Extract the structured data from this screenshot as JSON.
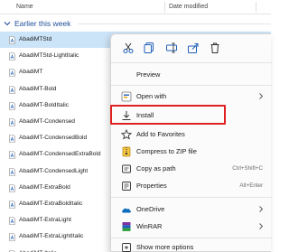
{
  "columns": {
    "name": "Name",
    "date": "Date modified"
  },
  "group": {
    "label": "Earlier this week"
  },
  "files": [
    "AbadiMTStd",
    "AbadiMTStd-LightItalic",
    "AbadiMT",
    "AbadiMT-Bold",
    "AbadiMT-BoldItalic",
    "AbadiMT-Condensed",
    "AbadiMT-CondensedBold",
    "AbadiMT-CondensedExtraBold",
    "AbadiMT-CondensedLight",
    "AbadiMT-ExtraBold",
    "AbadiMT-ExtraBoldItalic",
    "AbadiMT-ExtraLight",
    "AbadiMT-ExtraLightItalic",
    "AbadiMT-Italic"
  ],
  "context_menu": {
    "quick_actions": [
      "cut-icon",
      "copy-icon",
      "rename-icon",
      "share-icon",
      "delete-icon"
    ],
    "preview": "Preview",
    "open_with": "Open with",
    "install": "Install",
    "add_favorites": "Add to Favorites",
    "compress": "Compress to ZIP file",
    "copy_path": "Copy as path",
    "copy_path_shortcut": "Ctrl+Shift+C",
    "properties": "Properties",
    "properties_shortcut": "Alt+Enter",
    "onedrive": "OneDrive",
    "winrar": "WinRAR",
    "more_options": "Show more options"
  },
  "colors": {
    "accent": "#1f4e9b",
    "selection": "#cce4f7",
    "highlight": "#e02020"
  }
}
